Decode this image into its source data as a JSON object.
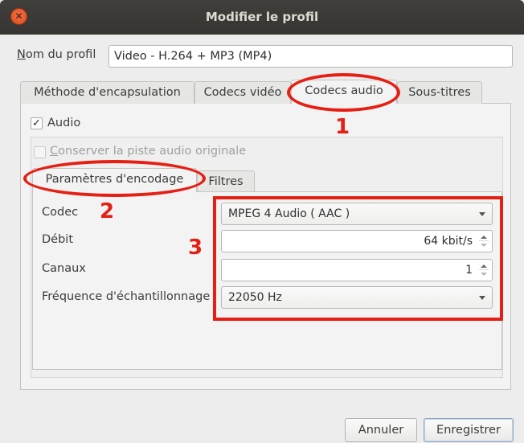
{
  "window": {
    "title": "Modifier le profil"
  },
  "profile": {
    "label_accel": "N",
    "label_rest": "om du profil",
    "value": "Video - H.264 + MP3 (MP4)"
  },
  "tabs": [
    {
      "label": "Méthode d'encapsulation"
    },
    {
      "label": "Codecs vidéo"
    },
    {
      "label": "Codecs audio"
    },
    {
      "label": "Sous-titres"
    }
  ],
  "audio": {
    "checkbox_label": "Audio",
    "checked_mark": "✓",
    "keep_original_label_accel": "C",
    "keep_original_label_rest": "onserver la piste audio originale",
    "subtabs": [
      {
        "label": "Paramètres d'encodage"
      },
      {
        "label": "Filtres"
      }
    ],
    "fields": {
      "codec_label": "Codec",
      "codec_value": "MPEG 4 Audio ( AAC )",
      "bitrate_label": "Débit",
      "bitrate_value": "64 kbit/s",
      "channels_label": "Canaux",
      "channels_value": "1",
      "samplerate_label": "Fréquence d'échantillonnage",
      "samplerate_value": "22050 Hz"
    }
  },
  "buttons": {
    "cancel": "Annuler",
    "save": "Enregistrer"
  },
  "annotations": {
    "n1": "1",
    "n2": "2",
    "n3": "3",
    "color": "#e61e13"
  },
  "icons": {
    "close": "close-icon",
    "dropdown": "chevron-down-icon",
    "spinner": "spinner-arrows-icon"
  }
}
